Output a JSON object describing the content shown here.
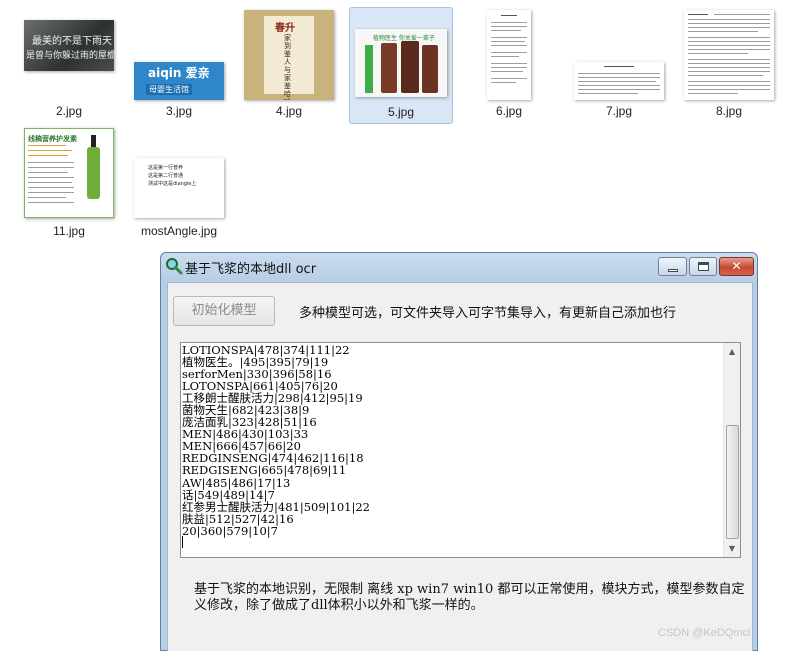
{
  "files": [
    {
      "name": "2.jpg",
      "img_text": [
        "最美的不是下雨天",
        "是曾与你躲过雨的屋檐"
      ]
    },
    {
      "name": "3.jpg",
      "img_text": [
        "aiqin 爱亲",
        "母婴生活馆"
      ]
    },
    {
      "name": "4.jpg",
      "img_text": [
        "春升",
        "家到鉴人与家鉴哈哈"
      ]
    },
    {
      "name": "5.jpg",
      "selected": true,
      "img_text": [
        "植物医生 你关爱一辈子"
      ]
    },
    {
      "name": "6.jpg"
    },
    {
      "name": "7.jpg"
    },
    {
      "name": "8.jpg"
    },
    {
      "name": "11.jpg",
      "img_text": [
        "线稿营养护发素"
      ]
    },
    {
      "name": "mostAngle.jpg",
      "img_text": [
        "这是第一行普养",
        "这是第二行普通",
        "测试中这是diangle上"
      ]
    }
  ],
  "dialog": {
    "title": "基于飞浆的本地dll ocr",
    "init_button": "初始化模型",
    "hint": "多种模型可选，可文件夹导入可字节集导入，有更新自己添加也行",
    "result_lines": [
      "LOTIONSPA|478|374|111|22",
      "植物医生。|495|395|79|19",
      "serforMen|330|396|58|16",
      "LOTONSPA|661|405|76|20",
      "工移朗士醒肤活力|298|412|95|19",
      "菌物天生|682|423|38|9",
      "庞洁面乳|323|428|51|16",
      "MEN|486|430|103|33",
      "MEN|666|457|66|20",
      "REDGINSENG|474|462|116|18",
      "REDGISENG|665|478|69|11",
      "AW|485|486|17|13",
      "话|549|489|14|7",
      "红参男士醒肤活力|481|509|101|22",
      "肤益|512|527|42|16",
      "20|360|579|10|7"
    ],
    "description": "基于飞浆的本地识别，无限制 离线 xp win7 win10 都可以正常使用，模块方式，模型参数自定义修改，除了做成了dll体积小以外和飞浆一样的。"
  },
  "watermark": "CSDN @KeDQmcl",
  "colors": {
    "accent": "#c64a32",
    "selection": "#d9e6f5",
    "title_grad": "#b7cde4"
  }
}
